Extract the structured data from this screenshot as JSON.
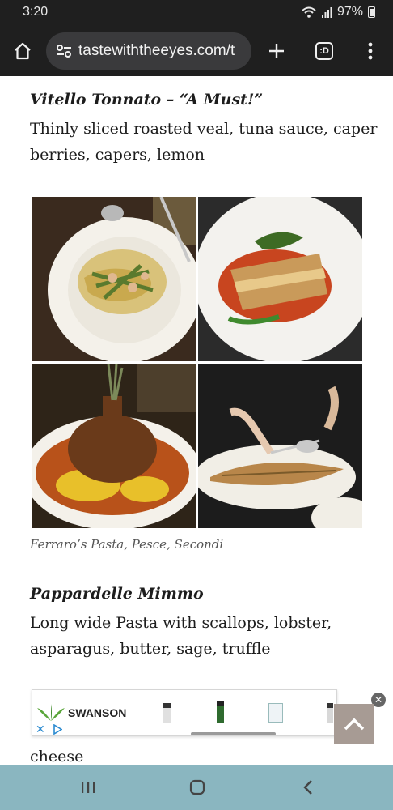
{
  "status": {
    "time": "3:20",
    "battery": "97%"
  },
  "browser": {
    "url": "tastewiththeeyes.com/t",
    "tab_count": ":D"
  },
  "article": {
    "dish1": {
      "title": "Vitello Tonnato – “A Must!”",
      "desc": "Thinly sliced roasted veal, tuna sauce, caper berries, capers, lemon"
    },
    "caption": "Ferraro’s Pasta, Pesce, Secondi",
    "dish2": {
      "title": "Pappardelle Mimmo",
      "desc": "Long wide Pasta with scallops, lobster, asparagus, butter, sage, truffle"
    },
    "partial_line": "cheese"
  },
  "ad": {
    "brand": "SWANSON"
  },
  "icons": [
    "home-icon",
    "site-settings-icon",
    "new-tab-icon",
    "tab-switcher-icon",
    "more-menu-icon",
    "wifi-icon",
    "signal-icon",
    "battery-icon",
    "close-icon",
    "chevron-up-icon",
    "recents-icon",
    "home-nav-icon",
    "back-icon"
  ]
}
